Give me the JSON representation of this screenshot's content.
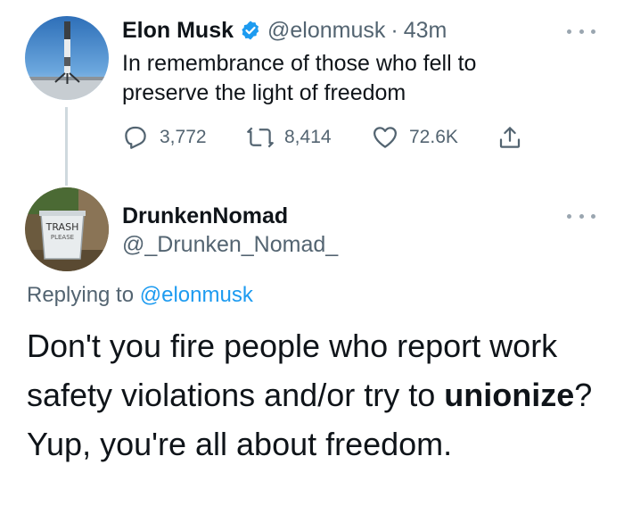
{
  "original_tweet": {
    "author_name": "Elon Musk",
    "handle": "@elonmusk",
    "separator": "·",
    "time": "43m",
    "text": "In remembrance of those who fell to preserve the light of freedom",
    "actions": {
      "reply_count": "3,772",
      "retweet_count": "8,414",
      "like_count": "72.6K"
    }
  },
  "reply_tweet": {
    "author_name": "DrunkenNomad",
    "handle": "@_Drunken_Nomad_",
    "replying_prefix": "Replying to",
    "replying_mention": "@elonmusk",
    "text_part1": "Don't you fire people who report work safety violations and/or try to ",
    "text_bold": "unionize",
    "text_part2": "? Yup, you're all about freedom.",
    "avatar_text_line1": "TRASH",
    "avatar_text_line2": "PLEASE"
  },
  "colors": {
    "accent": "#1d9bf0",
    "secondary_text": "#536471",
    "primary_text": "#0f1419"
  },
  "icons": [
    "verified-badge-icon",
    "reply-icon",
    "retweet-icon",
    "like-icon",
    "share-icon",
    "more-icon"
  ]
}
